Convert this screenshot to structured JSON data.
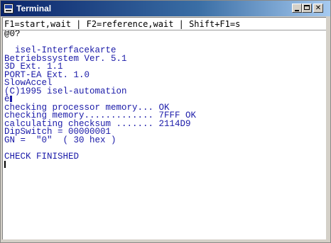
{
  "window": {
    "title": "Terminal",
    "icon": "terminal-app-icon",
    "controls": {
      "minimize_glyph": "",
      "maximize_glyph": "",
      "close_glyph": "✕"
    }
  },
  "shortcut_bar": {
    "text": "F1=start,wait | F2=reference,wait | Shift+F1=s"
  },
  "terminal": {
    "lines": [
      {
        "text": "@0?",
        "color": "black"
      },
      {
        "text": "",
        "color": "blue"
      },
      {
        "text": "  isel-Interfacekarte",
        "color": "blue"
      },
      {
        "text": "Betriebssystem Ver. 5.1",
        "color": "blue"
      },
      {
        "text": "3D Ext. 1.1",
        "color": "blue"
      },
      {
        "text": "PORT-EA Ext. 1.0",
        "color": "blue"
      },
      {
        "text": "SlowAccel",
        "color": "blue"
      },
      {
        "text": "(C)1995 isel-automation",
        "color": "blue"
      },
      {
        "text": "è",
        "color": "blue"
      },
      {
        "text": "checking processor memory... OK",
        "color": "blue"
      },
      {
        "text": "checking memory............. 7FFF OK",
        "color": "blue"
      },
      {
        "text": "calculating checksum ....... 2114D9",
        "color": "blue"
      },
      {
        "text": "DipSwitch = 00000001",
        "color": "blue"
      },
      {
        "text": "GN =  \"0\"  ( 30 hex )",
        "color": "blue"
      },
      {
        "text": "",
        "color": "blue"
      },
      {
        "text": "CHECK FINISHED",
        "color": "blue"
      },
      {
        "text": "",
        "color": "black"
      }
    ]
  },
  "colors": {
    "title_gradient_start": "#0a246a",
    "title_gradient_end": "#a6caf0",
    "terminal_text_blue": "#1a1aa8",
    "terminal_text_black": "#000000",
    "terminal_background": "#ffffff"
  }
}
